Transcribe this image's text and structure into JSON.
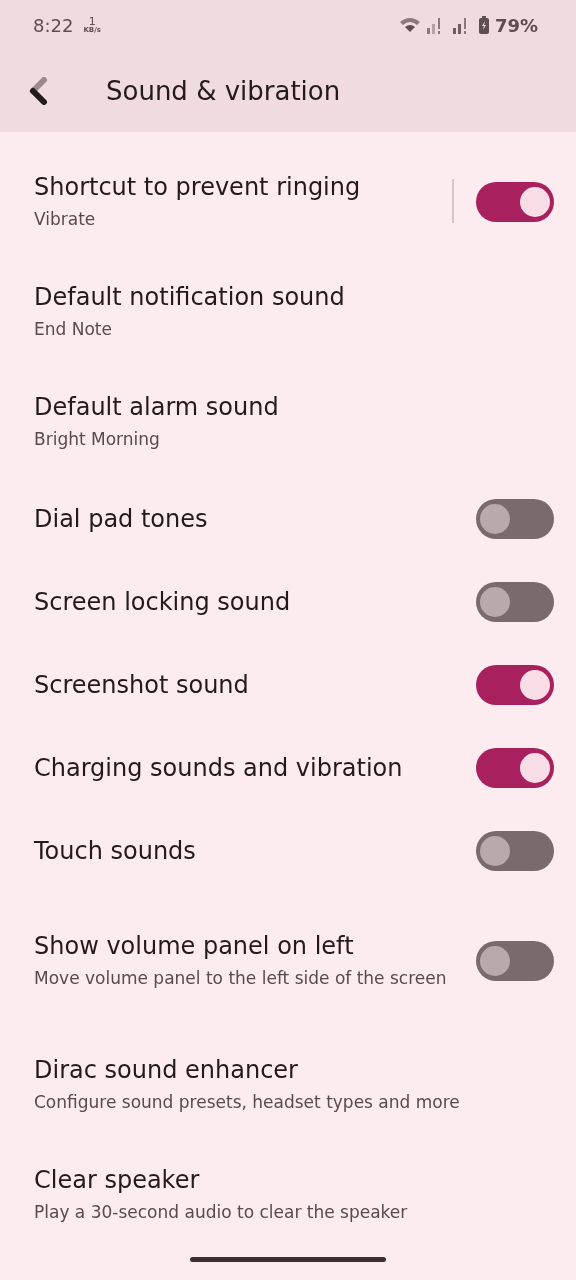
{
  "status_bar": {
    "time": "8:22",
    "speed_value": "1",
    "speed_unit": "KB/s",
    "battery": "79%"
  },
  "header": {
    "title": "Sound & vibration"
  },
  "settings": [
    {
      "kind": "split-toggle",
      "title": "Shortcut to prevent ringing",
      "summary": "Vibrate",
      "on": true
    },
    {
      "kind": "link",
      "title": "Default notification sound",
      "summary": "End Note"
    },
    {
      "kind": "link",
      "title": "Default alarm sound",
      "summary": "Bright Morning"
    },
    {
      "kind": "toggle",
      "title": "Dial pad tones",
      "on": false
    },
    {
      "kind": "toggle",
      "title": "Screen locking sound",
      "on": false
    },
    {
      "kind": "toggle",
      "title": "Screenshot sound",
      "on": true
    },
    {
      "kind": "toggle",
      "title": "Charging sounds and vibration",
      "on": true
    },
    {
      "kind": "toggle",
      "title": "Touch sounds",
      "on": false
    },
    {
      "kind": "toggle",
      "title": "Show volume panel on left",
      "summary": "Move volume panel to the left side of the screen",
      "on": false
    },
    {
      "kind": "link",
      "title": "Dirac sound enhancer",
      "summary": "Configure sound presets, headset types and more"
    },
    {
      "kind": "link",
      "title": "Clear speaker",
      "summary": "Play a 30-second audio to clear the speaker"
    }
  ]
}
